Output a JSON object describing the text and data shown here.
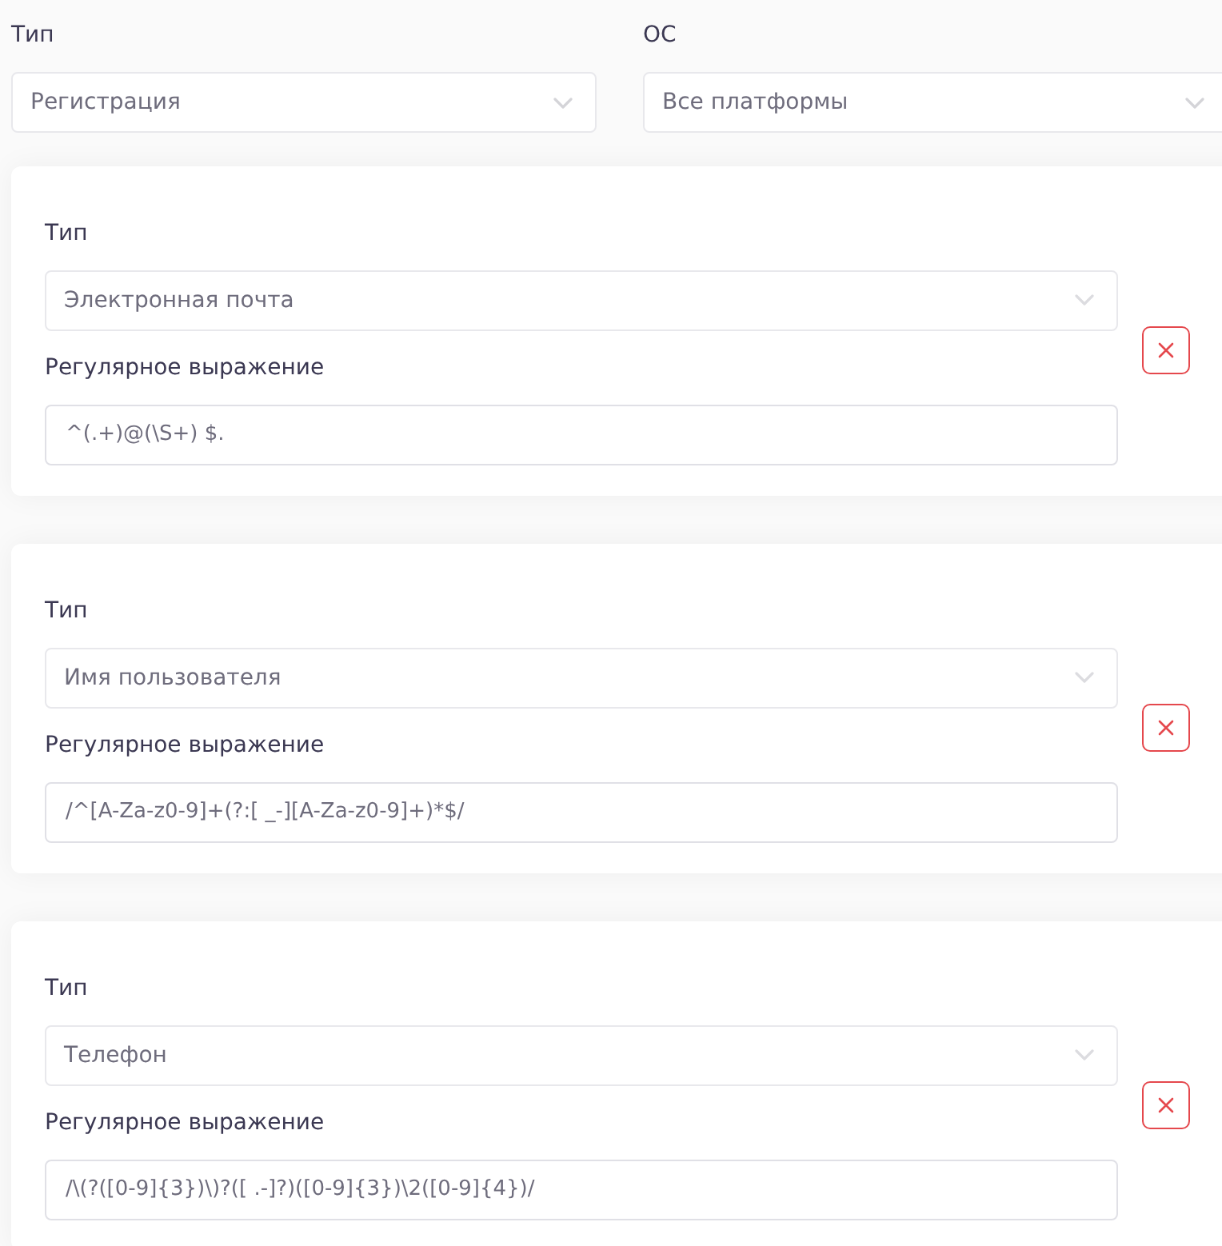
{
  "filters": [
    {
      "label": "Тип",
      "value": "Регистрация"
    },
    {
      "label": "ОС",
      "value": "Все платформы"
    }
  ],
  "rules": [
    {
      "type_label": "Тип",
      "type_value": "Электронная почта",
      "regex_label": "Регулярное выражение",
      "regex_value": "^(.+)@(\\S+) $."
    },
    {
      "type_label": "Тип",
      "type_value": "Имя пользователя",
      "regex_label": "Регулярное выражение",
      "regex_value": "/^[A-Za-z0-9]+(?:[ _-][A-Za-z0-9]+)*$/"
    },
    {
      "type_label": "Тип",
      "type_value": "Телефон",
      "regex_label": "Регулярное выражение",
      "regex_value": "/\\(?([0-9]{3})\\)?([ .-]?)([0-9]{3})\\2([0-9]{4})/"
    }
  ]
}
